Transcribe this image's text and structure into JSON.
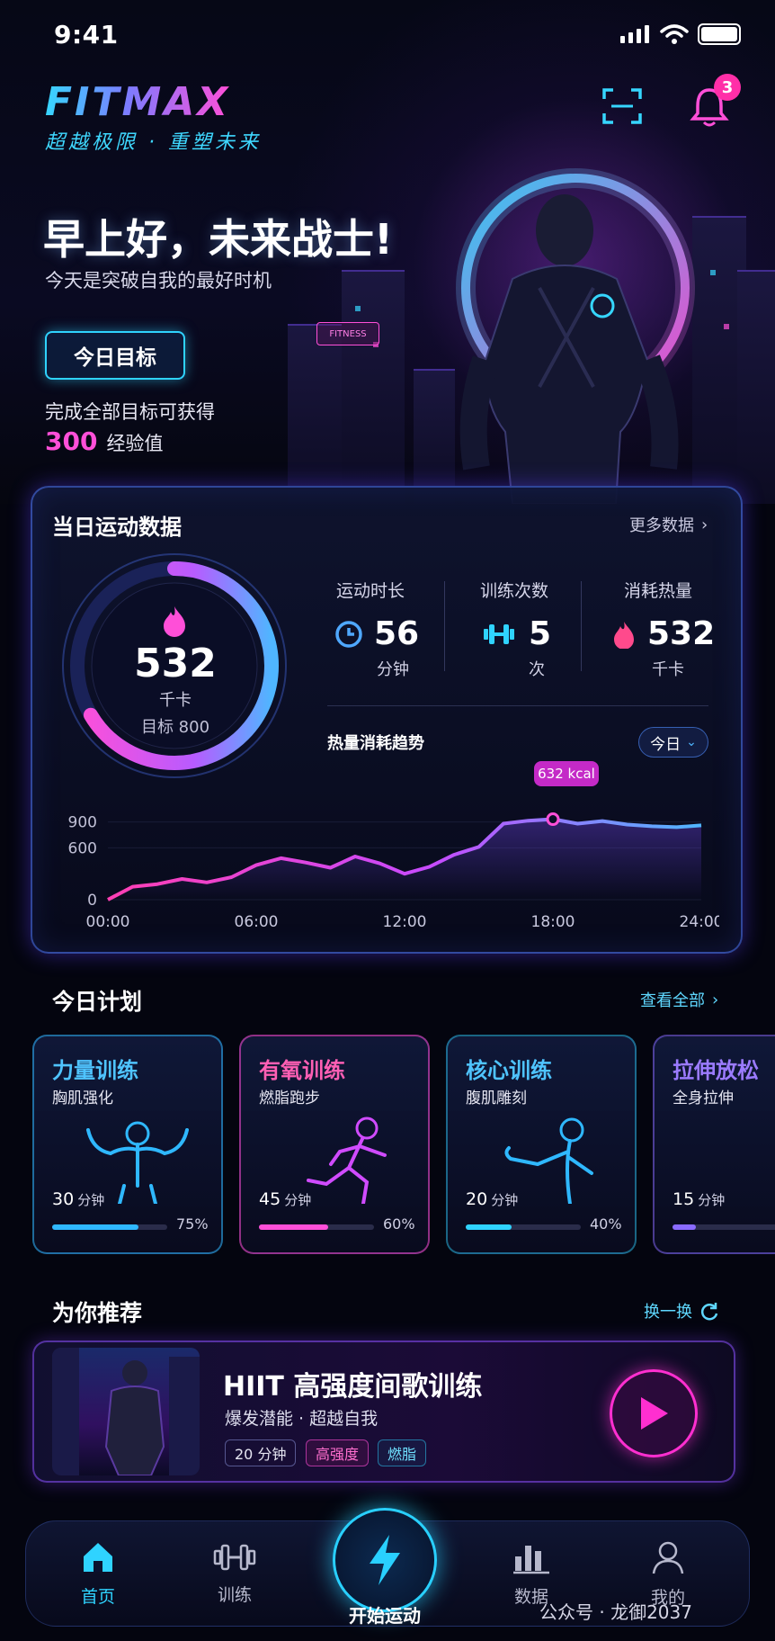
{
  "status_bar": {
    "time": "9:41"
  },
  "header": {
    "logo": "FITMAX",
    "slogan": "超越极限 · 重塑未来",
    "notification_count": "3"
  },
  "hero": {
    "greeting": "早上好，未来战士!",
    "subtitle": "今天是突破自我的最好时机",
    "goal_button": "今日目标",
    "goal_text": "完成全部目标可获得",
    "xp_value": "300",
    "xp_label": "经验值",
    "sign_text": "FITNESS"
  },
  "stats_card": {
    "title": "当日运动数据",
    "more_label": "更多数据",
    "ring": {
      "value": "532",
      "unit": "千卡",
      "target": "目标 800",
      "progress": 0.665
    },
    "stats": [
      {
        "label": "运动时长",
        "value": "56",
        "unit": "分钟",
        "icon": "clock-icon"
      },
      {
        "label": "训练次数",
        "value": "5",
        "unit": "次",
        "icon": "dumbbell-icon"
      },
      {
        "label": "消耗热量",
        "value": "532",
        "unit": "千卡",
        "icon": "flame-icon"
      }
    ],
    "trend_title": "热量消耗趋势",
    "period": "今日"
  },
  "chart_data": {
    "type": "line",
    "x_labels": [
      "00:00",
      "06:00",
      "12:00",
      "18:00",
      "24:00"
    ],
    "y_ticks": [
      "900",
      "600",
      "0"
    ],
    "x": [
      0,
      1,
      2,
      3,
      4,
      5,
      6,
      7,
      8,
      9,
      10,
      11,
      12,
      13,
      14,
      15,
      16,
      17,
      18,
      19,
      20,
      21,
      22,
      23,
      24
    ],
    "y": [
      0,
      150,
      180,
      240,
      200,
      260,
      400,
      480,
      430,
      370,
      500,
      420,
      300,
      380,
      520,
      610,
      880,
      915,
      932,
      880,
      910,
      870,
      850,
      840,
      860
    ],
    "peak_label": "632 kcal",
    "peak_x": 18,
    "colors": {
      "start": "#ff3fb4",
      "mid": "#c64bff",
      "end": "#4fb6ff"
    }
  },
  "plan": {
    "title": "今日计划",
    "link": "查看全部",
    "items": [
      {
        "name": "力量训练",
        "sub": "胸肌强化",
        "duration": "30",
        "unit": "分钟",
        "pct_label": "75%",
        "progress": 0.75,
        "color": "#2fb8ff",
        "figure": "bodybuilder-icon"
      },
      {
        "name": "有氧训练",
        "sub": "燃脂跑步",
        "duration": "45",
        "unit": "分钟",
        "pct_label": "60%",
        "progress": 0.6,
        "color": "#ff4fd8",
        "figure": "runner-icon"
      },
      {
        "name": "核心训练",
        "sub": "腹肌雕刻",
        "duration": "20",
        "unit": "分钟",
        "pct_label": "40%",
        "progress": 0.4,
        "color": "#2fd3ff",
        "figure": "boxer-icon"
      },
      {
        "name": "拉伸放松",
        "sub": "全身拉伸",
        "duration": "15",
        "unit": "分钟",
        "pct_label": "",
        "progress": 0.2,
        "color": "#8a6bff",
        "figure": "stretch-icon"
      }
    ]
  },
  "recommend": {
    "title": "为你推荐",
    "link": "换一换",
    "card_title": "HIIT 高强度间歌训练",
    "card_sub": "爆发潜能 · 超越自我",
    "tags": [
      "20 分钟",
      "高强度",
      "燃脂"
    ]
  },
  "tabbar": {
    "items": [
      "首页",
      "训练",
      "开始运动",
      "数据",
      "我的"
    ]
  },
  "watermark": "公众号 · 龙御2037"
}
